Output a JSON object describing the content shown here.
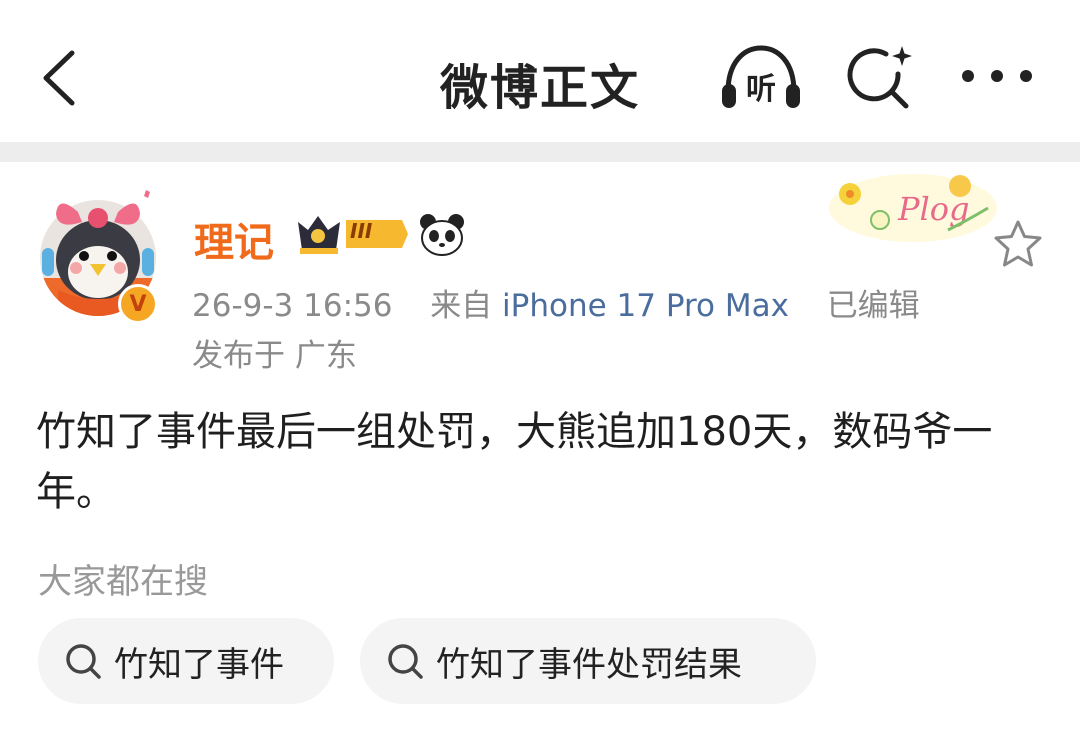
{
  "nav": {
    "title": "微博正文",
    "listen_label": "听",
    "icons": [
      "back-arrow-icon",
      "headphone-icon",
      "search-sparkle-icon",
      "more-dots-icon"
    ]
  },
  "post": {
    "author": {
      "name": "理记",
      "vip_level": "III",
      "verified_badge": "V",
      "badges": [
        "crown-vip-badge",
        "panda-badge"
      ]
    },
    "meta": {
      "timestamp": "26-9-3 16:56",
      "source_prefix": "来自",
      "device": "iPhone 17 Pro Max",
      "edited": "已编辑",
      "location_prefix": "发布于",
      "location": "广东"
    },
    "decoration": "Plog",
    "content": "竹知了事件最后一组处罚，大熊追加180天，数码爷一年。"
  },
  "trending": {
    "label": "大家都在搜",
    "items": [
      {
        "label": "竹知了事件"
      },
      {
        "label": "竹知了事件处罚结果"
      }
    ]
  },
  "colors": {
    "username": "#f06a1b",
    "device_link": "#4a6d9e",
    "meta_text": "#8a8a8a",
    "chip_bg": "#f4f4f4",
    "divider": "#ededed"
  }
}
